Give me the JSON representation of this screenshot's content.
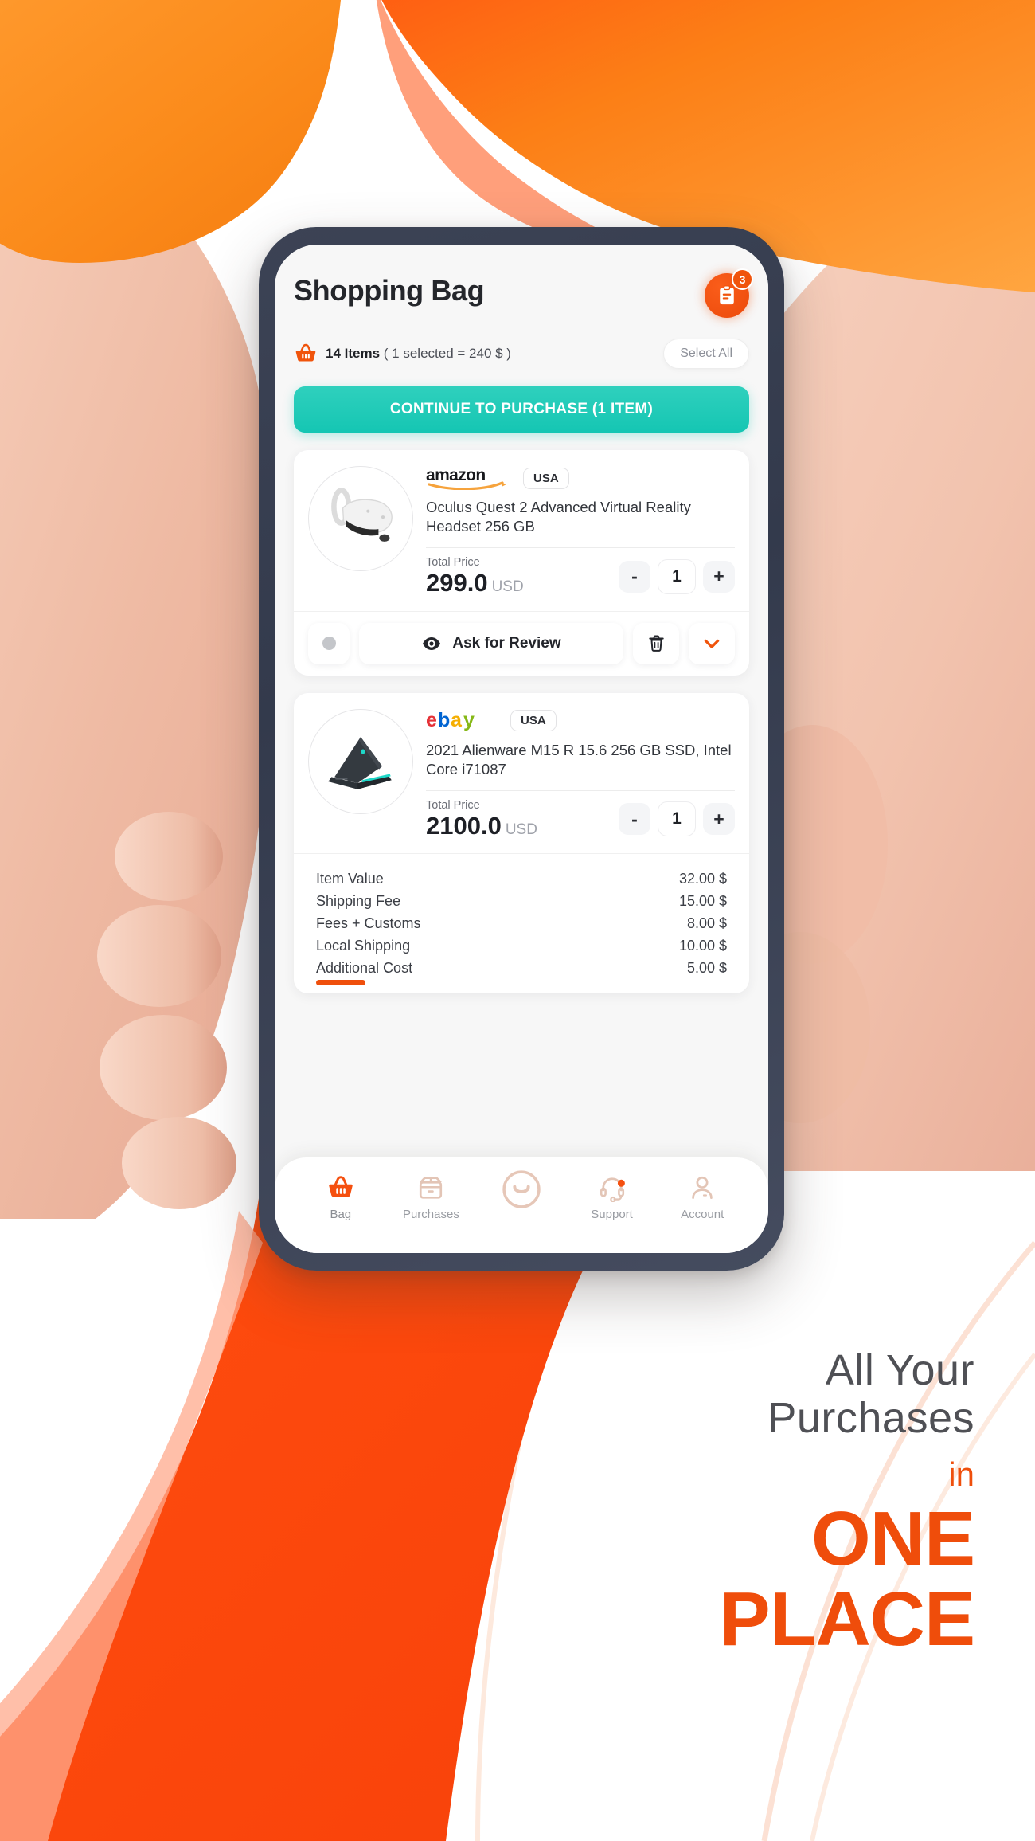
{
  "poster": {
    "headline_line1": "All Your",
    "headline_line2": "Purchases",
    "headline_in": "in",
    "headline_big1": "ONE",
    "headline_big2": "PLACE",
    "accent_color": "#ef4d0b",
    "headline_color": "#4f5055"
  },
  "app": {
    "title": "Shopping Bag",
    "notification": {
      "icon": "clipboard-icon",
      "badge_count": "3",
      "color": "#f0540c"
    },
    "summary": {
      "basket_icon": "basket-icon",
      "count_label": "14 Items",
      "detail_label": "( 1 selected = 240 $ )",
      "select_all_label": "Select All"
    },
    "cta": {
      "label": "CONTINUE TO PURCHASE (1 ITEM)",
      "color": "#15c6b3"
    },
    "products": [
      {
        "store": "amazon",
        "store_logo": "amazon-logo",
        "country": "USA",
        "title": "Oculus Quest 2 Advanced Virtual Reality Headset 256 GB",
        "thumb": "vr-headset-image",
        "price_label": "Total Price",
        "price": "299.0",
        "currency": "USD",
        "qty": "1",
        "minus_label": "-",
        "plus_label": "+",
        "actions": {
          "select_dot": "selection-dot",
          "review_icon": "eye-icon",
          "review_label": "Ask for Review",
          "delete_icon": "trash-icon",
          "expand_icon": "chevron-down-icon"
        }
      },
      {
        "store": "ebay",
        "store_logo": "ebay-logo",
        "country": "USA",
        "title": "2021 Alienware M15 R 15.6 256 GB SSD, Intel Core i71087",
        "thumb": "laptop-image",
        "price_label": "Total Price",
        "price": "2100.0",
        "currency": "USD",
        "qty": "1",
        "minus_label": "-",
        "plus_label": "+"
      }
    ],
    "cost_breakdown": [
      {
        "label": "Item Value",
        "value": "32.00 $"
      },
      {
        "label": "Shipping Fee",
        "value": "15.00 $"
      },
      {
        "label": "Fees + Customs",
        "value": "8.00 $"
      },
      {
        "label": "Local Shipping",
        "value": "10.00 $"
      },
      {
        "label": "Additional Cost",
        "value": "5.00 $"
      }
    ],
    "bottom_nav": [
      {
        "label": "Bag",
        "icon": "basket-icon",
        "active": true
      },
      {
        "label": "Purchases",
        "icon": "box-icon",
        "active": false
      },
      {
        "label": "",
        "icon": "smiley-icon",
        "active": false
      },
      {
        "label": "Support",
        "icon": "headset-icon",
        "active": false
      },
      {
        "label": "Account",
        "icon": "person-icon",
        "active": false
      }
    ]
  }
}
